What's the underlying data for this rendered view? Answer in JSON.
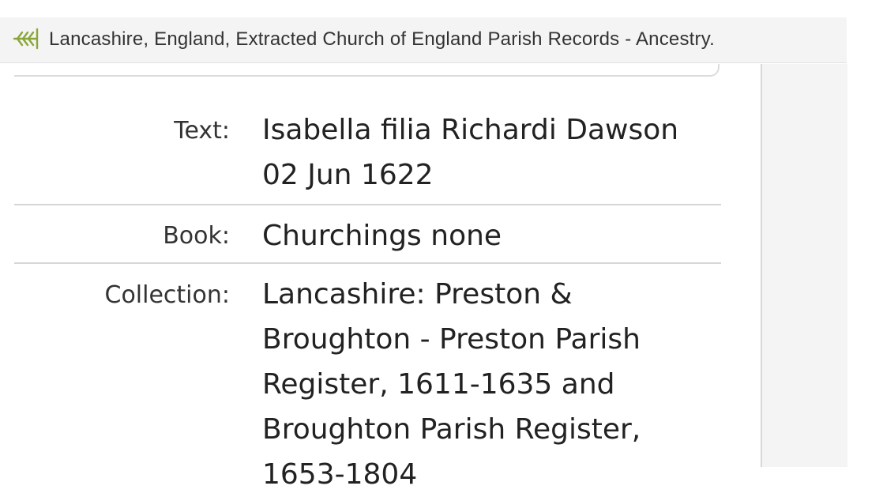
{
  "tab": {
    "title": "Lancashire, England, Extracted Church of England Parish Records - Ancestry.",
    "favicon": "ancestry-leaf-icon",
    "favicon_color": "#8aa63a"
  },
  "record": {
    "rows": [
      {
        "label": "Text:",
        "value": "Isabella filia Richardi Dawson 02 Jun 1622"
      },
      {
        "label": "Book:",
        "value": "Churchings none"
      },
      {
        "label": "Collection:",
        "value": "Lancashire: Preston & Broughton - Preston Parish Register, 1611-1635 and Broughton Parish Register, 1653-1804"
      }
    ]
  }
}
